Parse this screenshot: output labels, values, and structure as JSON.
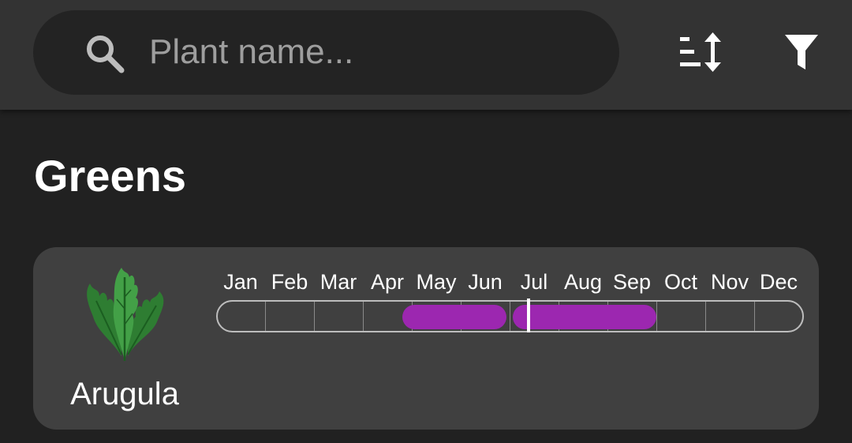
{
  "search": {
    "placeholder": "Plant name...",
    "value": "",
    "icon": "search-icon"
  },
  "toolbar": {
    "sort_icon": "sort-icon",
    "filter_icon": "filter-icon"
  },
  "colors": {
    "background": "#212121",
    "topbar": "#333333",
    "card": "#404040",
    "season_bar": "#9c27b0",
    "text": "#ffffff"
  },
  "sections": [
    {
      "title": "Greens",
      "plants": [
        {
          "name": "Arugula",
          "icon": "arugula-leaf-icon",
          "months": [
            "Jan",
            "Feb",
            "Mar",
            "Apr",
            "May",
            "Jun",
            "Jul",
            "Aug",
            "Sep",
            "Oct",
            "Nov",
            "Dec"
          ],
          "seasons": [
            {
              "start_month": 4.8,
              "end_month": 7.0
            },
            {
              "start_month": 7.0,
              "end_month": 10.0
            }
          ],
          "current_month": 7.0
        }
      ]
    }
  ]
}
